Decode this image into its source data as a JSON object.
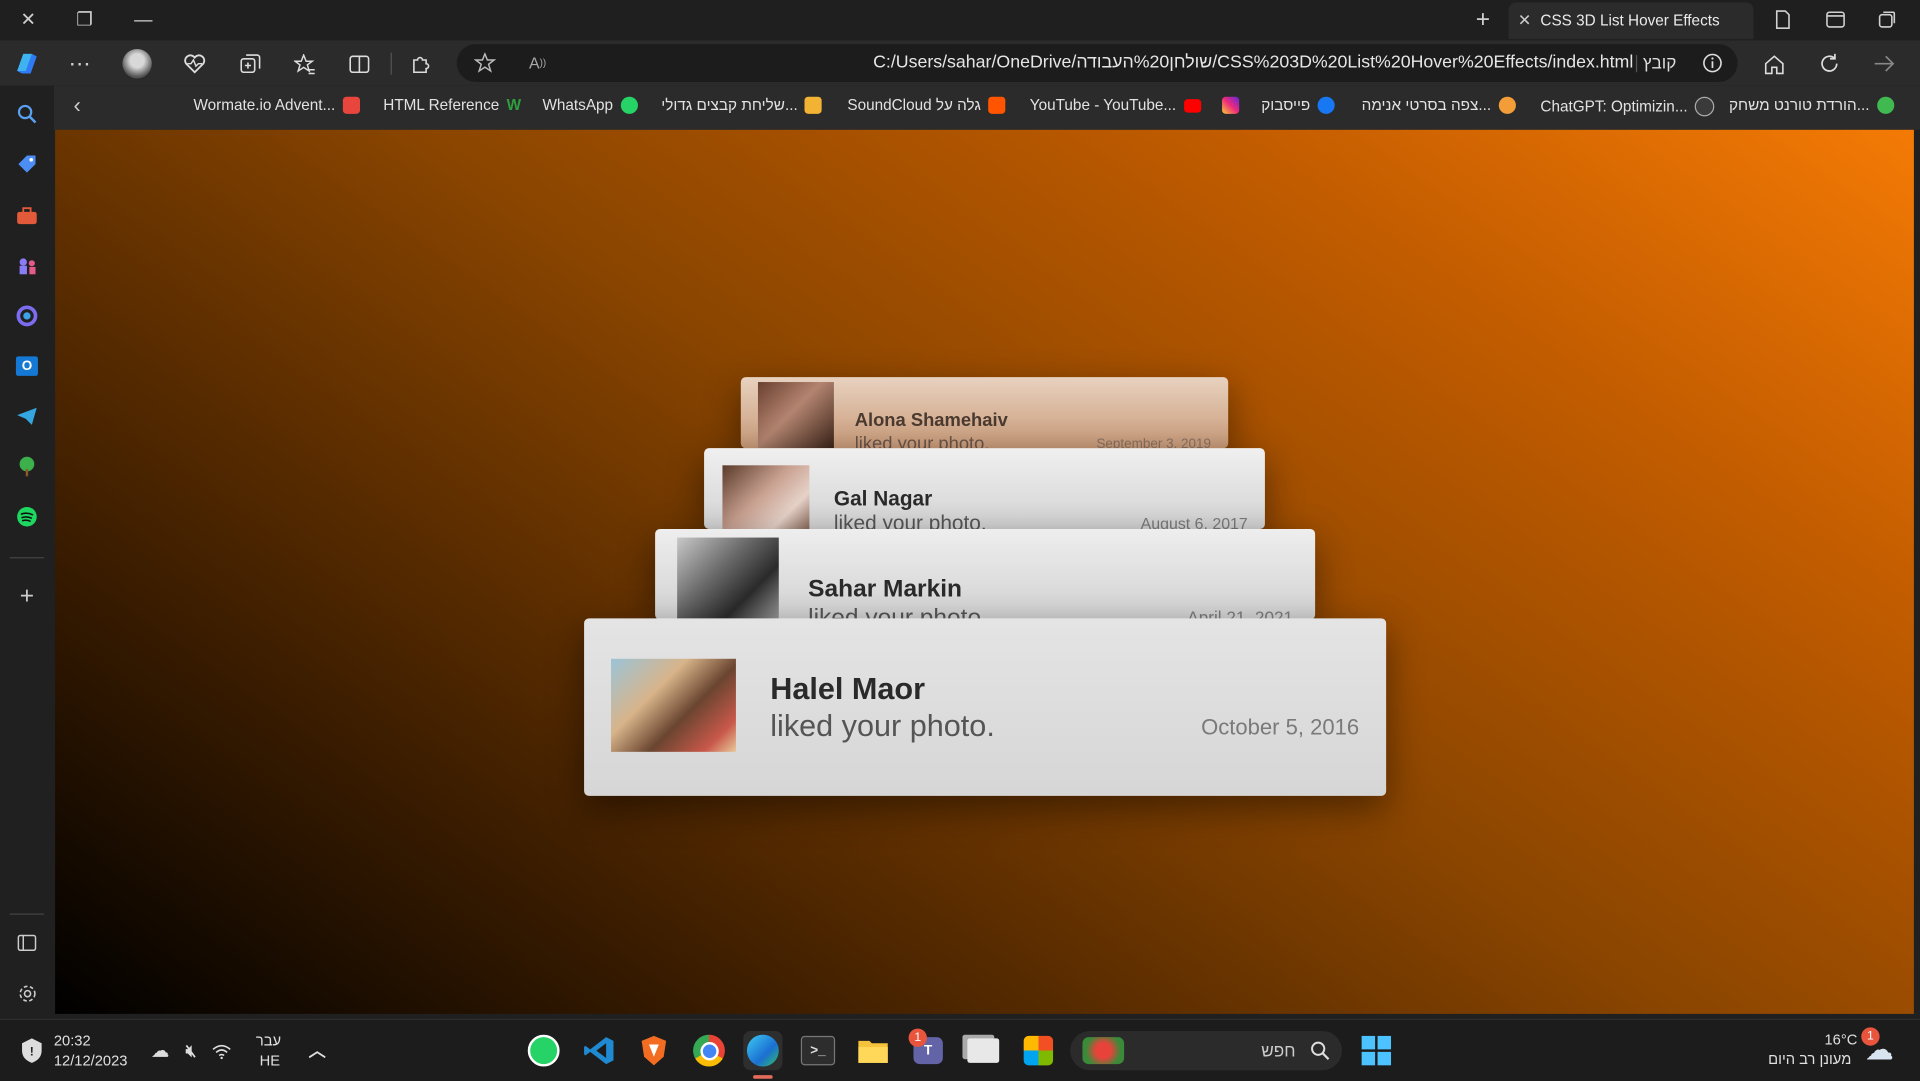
{
  "window": {
    "close_glyph": "✕",
    "restore_glyph": "❐",
    "minimize_glyph": "—",
    "new_tab_glyph": "+",
    "tab_title": "CSS 3D List Hover Effects"
  },
  "toolbar": {
    "url": "C:/Users/sahar/OneDrive/שולחן%20העבודה/CSS%203D%20List%20Hover%20Effects/index.html",
    "file_label": "קובץ"
  },
  "bookmarks": [
    {
      "label": "Wormate.io Advent...",
      "color": "#e8463c"
    },
    {
      "label": "HTML Reference",
      "color": "#2e9e3e"
    },
    {
      "label": "WhatsApp",
      "color": "#25d366"
    },
    {
      "label": "שליחת קבצים גדולי...",
      "color": "#f2b233"
    },
    {
      "label": "SoundCloud גלה על",
      "color": "#ff5500"
    },
    {
      "label": "YouTube - YouTube...",
      "color": "#ff0000"
    },
    {
      "label": "",
      "color": "#d6249f"
    },
    {
      "label": "פייסבוק",
      "color": "#1877f2"
    },
    {
      "label": "צפה בסרטי אנימה...",
      "color": "#f29d38"
    },
    {
      "label": "ChatGPT: Optimizin...",
      "color": "#9a9a9a"
    },
    {
      "label": "הורדת טורנט משחק...",
      "color": "#3fb950"
    }
  ],
  "cards": [
    {
      "name": "Alona Shamehaiv",
      "message": "liked your photo.",
      "date": "September 3, 2019"
    },
    {
      "name": "Gal Nagar",
      "message": "liked your photo.",
      "date": "August 6, 2017"
    },
    {
      "name": "Sahar Markin",
      "message": "liked your photo.",
      "date": "April 21, 2021"
    },
    {
      "name": "Halel Maor",
      "message": "liked your photo.",
      "date": "October 5, 2016"
    }
  ],
  "taskbar": {
    "time": "20:32",
    "date": "12/12/2023",
    "lang_top": "עבר",
    "lang_bottom": "HE",
    "search_placeholder": "חפש",
    "weather_temp": "16°C",
    "weather_text": "מעונן רב היום",
    "notification_count": "1",
    "teams_badge": "1"
  }
}
